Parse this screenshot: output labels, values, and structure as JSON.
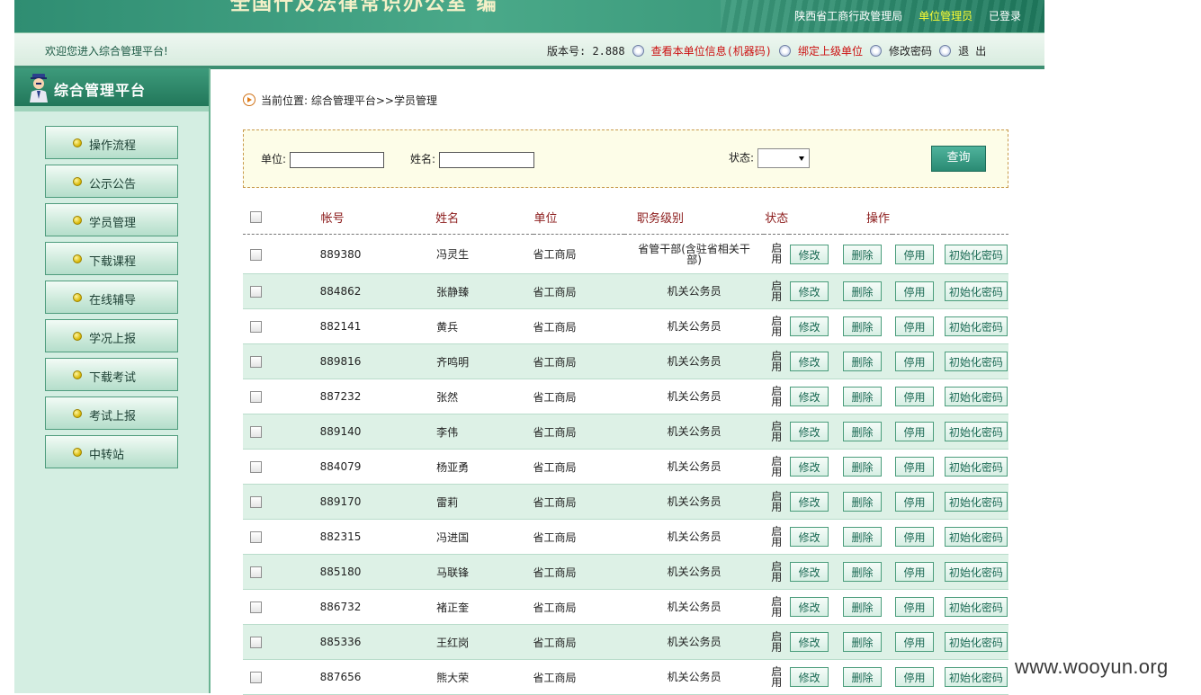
{
  "banner": {
    "title": "全国什及法律常识办公室 编",
    "org": "陕西省工商行政管理局",
    "role": "单位管理员",
    "login_status": "已登录"
  },
  "infobar": {
    "welcome": "欢迎您进入综合管理平台!",
    "version_label": "版本号: 2.888",
    "view_unit_info": "查看本单位信息(机器码)",
    "bind_parent": "绑定上级单位",
    "change_password": "修改密码",
    "logout": "退 出"
  },
  "sidebar": {
    "title": "综合管理平台",
    "items": [
      {
        "label": "操作流程"
      },
      {
        "label": "公示公告"
      },
      {
        "label": "学员管理"
      },
      {
        "label": "下载课程"
      },
      {
        "label": "在线辅导"
      },
      {
        "label": "学况上报"
      },
      {
        "label": "下载考试"
      },
      {
        "label": "考试上报"
      },
      {
        "label": "中转站"
      }
    ]
  },
  "breadcrumb": "当前位置: 综合管理平台>>学员管理",
  "search": {
    "unit_label": "单位:",
    "unit_value": "",
    "name_label": "姓名:",
    "name_value": "",
    "status_label": "状态:",
    "status_value": "",
    "query_button": "查询"
  },
  "table": {
    "headers": {
      "account": "帐号",
      "name": "姓名",
      "unit": "单位",
      "level": "职务级别",
      "status": "状态",
      "actions": "操作"
    },
    "action_labels": {
      "edit": "修改",
      "delete": "删除",
      "disable": "停用",
      "reset": "初始化密码"
    },
    "rows": [
      {
        "account": "889380",
        "name": "冯灵生",
        "unit": "省工商局",
        "level": "省管干部(含驻省相关干部)",
        "status": "启用"
      },
      {
        "account": "884862",
        "name": "张静臻",
        "unit": "省工商局",
        "level": "机关公务员",
        "status": "启用"
      },
      {
        "account": "882141",
        "name": "黄兵",
        "unit": "省工商局",
        "level": "机关公务员",
        "status": "启用"
      },
      {
        "account": "889816",
        "name": "齐鸣明",
        "unit": "省工商局",
        "level": "机关公务员",
        "status": "启用"
      },
      {
        "account": "887232",
        "name": "张然",
        "unit": "省工商局",
        "level": "机关公务员",
        "status": "启用"
      },
      {
        "account": "889140",
        "name": "李伟",
        "unit": "省工商局",
        "level": "机关公务员",
        "status": "启用"
      },
      {
        "account": "884079",
        "name": "杨亚勇",
        "unit": "省工商局",
        "level": "机关公务员",
        "status": "启用"
      },
      {
        "account": "889170",
        "name": "雷莉",
        "unit": "省工商局",
        "level": "机关公务员",
        "status": "启用"
      },
      {
        "account": "882315",
        "name": "冯进国",
        "unit": "省工商局",
        "level": "机关公务员",
        "status": "启用"
      },
      {
        "account": "885180",
        "name": "马联锋",
        "unit": "省工商局",
        "level": "机关公务员",
        "status": "启用"
      },
      {
        "account": "886732",
        "name": "褚正奎",
        "unit": "省工商局",
        "level": "机关公务员",
        "status": "启用"
      },
      {
        "account": "885336",
        "name": "王红岗",
        "unit": "省工商局",
        "level": "机关公务员",
        "status": "启用"
      },
      {
        "account": "887656",
        "name": "熊大荣",
        "unit": "省工商局",
        "level": "机关公务员",
        "status": "启用"
      }
    ]
  },
  "watermark": "www.wooyun.org"
}
